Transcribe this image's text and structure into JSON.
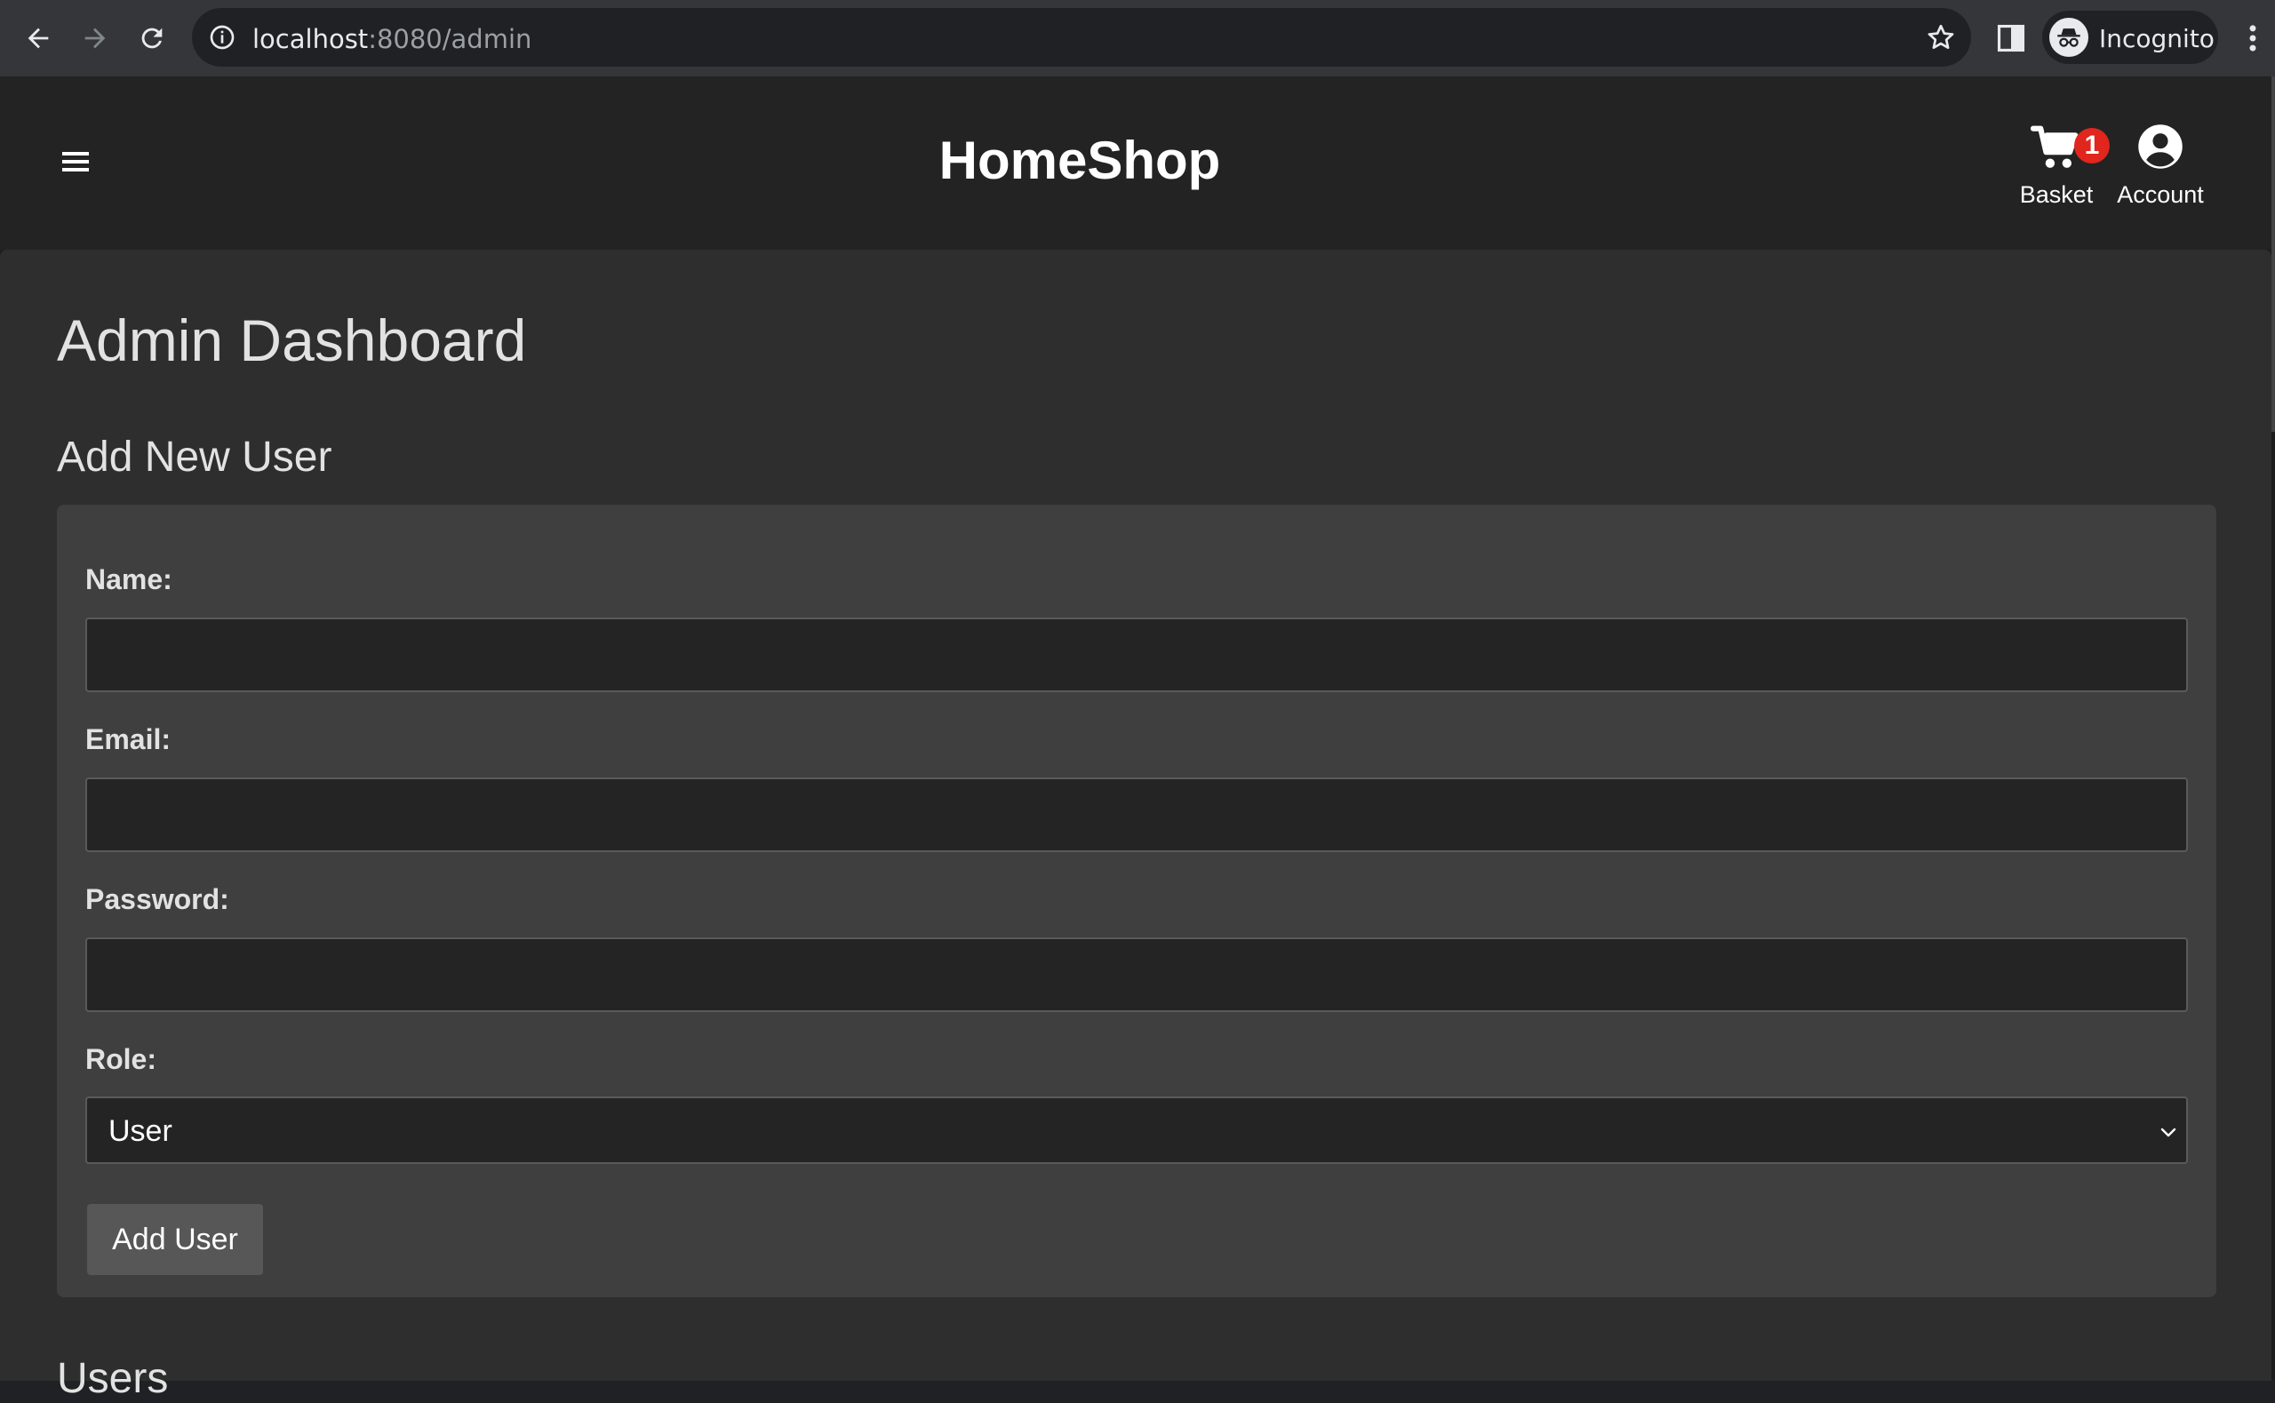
{
  "browser": {
    "url_host": "localhost",
    "url_rest": ":8080/admin",
    "profile_label": "Incognito",
    "icons": [
      "back-icon",
      "forward-icon",
      "reload-icon",
      "info-icon",
      "star-icon",
      "side-panel-icon",
      "incognito-icon",
      "more-icon"
    ]
  },
  "header": {
    "brand": "HomeShop",
    "basket_label": "Basket",
    "basket_count": "1",
    "account_label": "Account",
    "icons": [
      "hamburger-icon",
      "cart-icon",
      "account-icon"
    ]
  },
  "main": {
    "title": "Admin Dashboard",
    "form_title": "Add New User",
    "fields": {
      "name_label": "Name:",
      "name_value": "",
      "email_label": "Email:",
      "email_value": "",
      "password_label": "Password:",
      "password_value": "",
      "role_label": "Role:",
      "role_value": "User"
    },
    "submit_label": "Add User",
    "users_title": "Users"
  },
  "colors": {
    "badge": "#e0261d",
    "header_bg": "#232323",
    "main_bg": "#2e2e2e",
    "card_bg": "#3f3f3f",
    "button_bg": "#575757"
  }
}
